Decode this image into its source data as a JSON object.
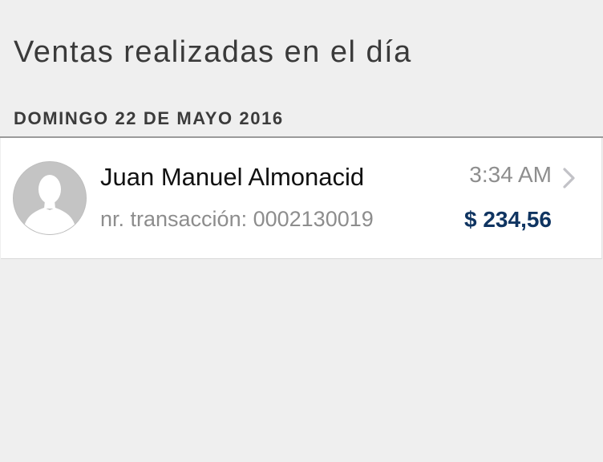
{
  "page": {
    "title": "Ventas realizadas en el día"
  },
  "section": {
    "date_header": "DOMINGO 22 DE MAYO 2016"
  },
  "sales": [
    {
      "customer_name": "Juan Manuel Almonacid",
      "transaction_label": "nr. transacción: 0002130019",
      "time": "3:34 AM",
      "amount": "$ 234,56",
      "avatar_icon": "person-placeholder-icon",
      "disclosure_icon": "chevron-right-icon"
    }
  ],
  "colors": {
    "background": "#efefef",
    "row_background": "#ffffff",
    "amount": "#0f3461",
    "secondary_text": "#8d8d8d"
  }
}
